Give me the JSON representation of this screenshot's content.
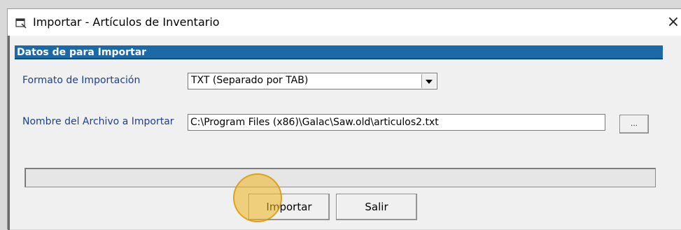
{
  "window": {
    "title": "Importar - Artículos de Inventario",
    "close_symbol": "×"
  },
  "section": {
    "header": "Datos de para  Importar"
  },
  "form": {
    "format_label": "Formato de Importación",
    "format_value": "TXT (Separado por TAB)",
    "file_label": "Nombre del Archivo a Importar",
    "file_value": "C:\\Program Files (x86)\\Galac\\Saw.old\\articulos2.txt",
    "browse_label": "..."
  },
  "progress": {
    "value": 0
  },
  "buttons": {
    "import_label": "Importar",
    "exit_label": "Salir"
  },
  "colors": {
    "header_bg": "#1b6aa7",
    "label_text": "#1d3f8c",
    "cursor_highlight": "#f0b41e"
  },
  "icons": {
    "app": "window-app-icon",
    "close": "close-icon",
    "combo_arrow": "chevron-down-icon"
  }
}
